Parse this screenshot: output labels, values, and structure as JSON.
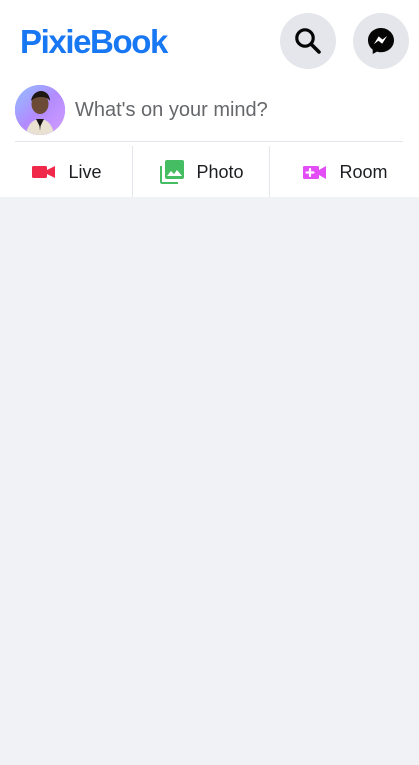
{
  "app": {
    "title": "PixieBook"
  },
  "header": {
    "search_icon": "search-icon",
    "messenger_icon": "messenger-icon"
  },
  "composer": {
    "placeholder": "What's on your mind?",
    "avatar": "user-avatar"
  },
  "actions": [
    {
      "label": "Live",
      "icon": "video-camera-icon",
      "color": "#f02849"
    },
    {
      "label": "Photo",
      "icon": "photo-library-icon",
      "color": "#45bd62"
    },
    {
      "label": "Room",
      "icon": "video-call-add-icon",
      "color": "#e24df5"
    }
  ],
  "colors": {
    "brand": "#1877f2",
    "page_background": "#f0f2f5",
    "card_background": "#ffffff",
    "button_background": "#e4e6eb",
    "muted_text": "#65676b"
  }
}
